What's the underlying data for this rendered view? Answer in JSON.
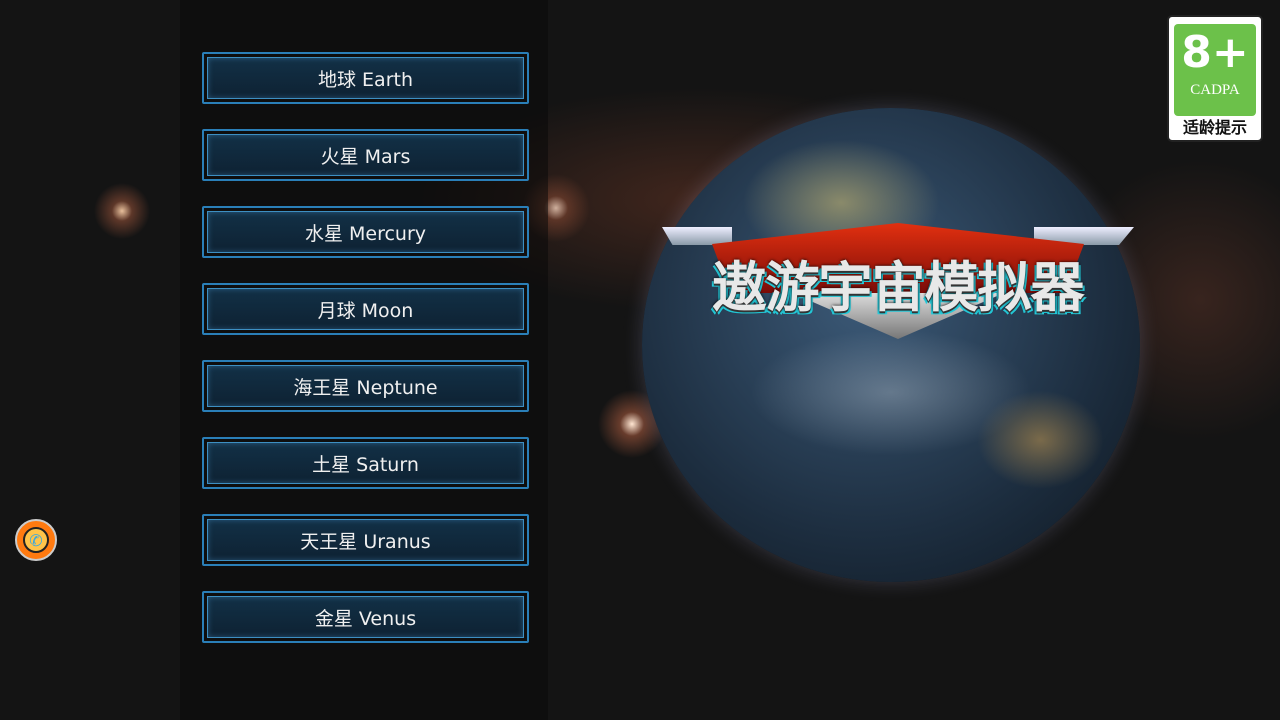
{
  "menu": {
    "items": [
      {
        "label": "地球 Earth"
      },
      {
        "label": "火星 Mars"
      },
      {
        "label": "水星 Mercury"
      },
      {
        "label": "月球 Moon"
      },
      {
        "label": "海王星 Neptune"
      },
      {
        "label": "土星 Saturn"
      },
      {
        "label": "天王星 Uranus"
      },
      {
        "label": "金星 Venus"
      }
    ]
  },
  "logo": {
    "title": "遨游宇宙模拟器"
  },
  "age_rating": {
    "age": "8+",
    "org": "CADPA",
    "hint": "适龄提示",
    "color": "#6cc14a"
  },
  "contact": {
    "icon": "phone-chat-icon"
  }
}
